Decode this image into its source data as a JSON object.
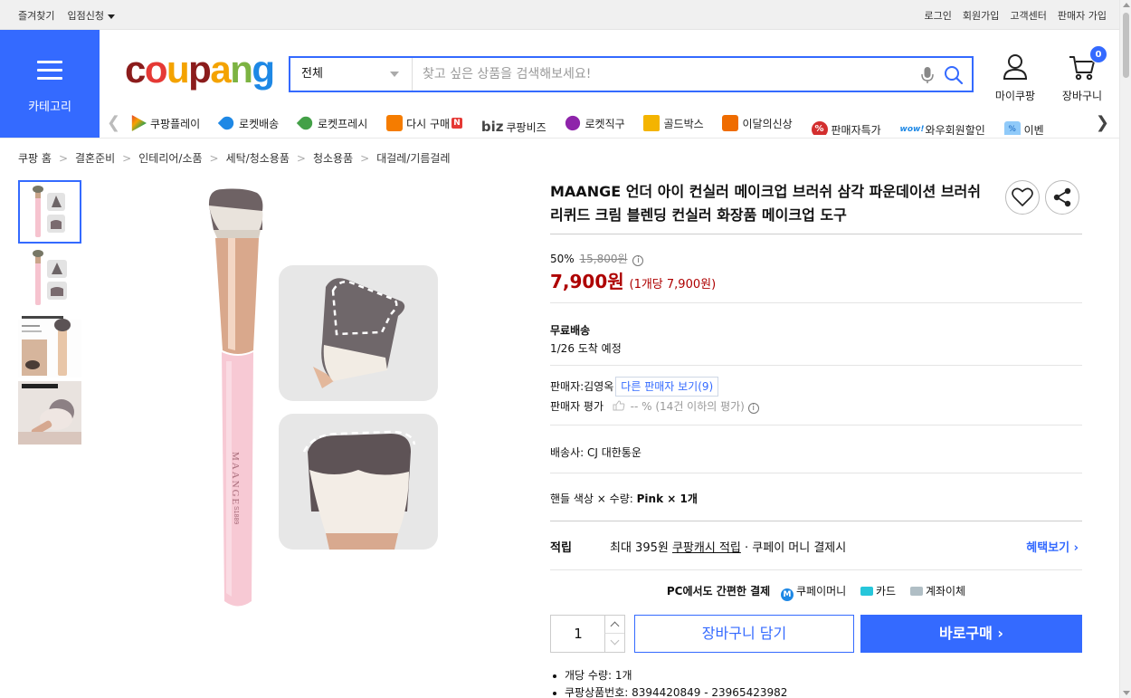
{
  "topbar": {
    "favorites": "즐겨찾기",
    "apply": "입점신청",
    "login": "로그인",
    "signup": "회원가입",
    "customer_center": "고객센터",
    "seller_signup": "판매자 가입"
  },
  "header": {
    "category_label": "카테고리",
    "logo": [
      "c",
      "o",
      "u",
      "p",
      "a",
      "n",
      "g"
    ],
    "search": {
      "category": "전체",
      "placeholder": "찾고 싶은 상품을 검색해보세요!"
    },
    "mycoupang": "마이쿠팡",
    "cart": "장바구니",
    "cart_count": "0",
    "brand_color": "#346aff"
  },
  "service_nav": [
    {
      "icon": "play-icon",
      "label": "쿠팡플레이"
    },
    {
      "icon": "rocket-delivery-icon",
      "label": "로켓배송"
    },
    {
      "icon": "rocket-fresh-icon",
      "label": "로켓프레시"
    },
    {
      "icon": "reorder-icon",
      "label": "다시 구매",
      "badge": "N"
    },
    {
      "icon": "biz-icon",
      "label": "쿠팡비즈",
      "prefix": "biz"
    },
    {
      "icon": "rocket-direct-icon",
      "label": "로켓직구"
    },
    {
      "icon": "goldbox-icon",
      "label": "골드박스"
    },
    {
      "icon": "new-product-icon",
      "label": "이달의신상"
    },
    {
      "icon": "percent-icon",
      "label": "판매자특가",
      "prefix": "%"
    },
    {
      "icon": "wow-icon",
      "label": "와우회원할인",
      "prefix": "wow!"
    },
    {
      "icon": "event-icon",
      "label": "이벤",
      "prefix": "%"
    }
  ],
  "breadcrumb": [
    "쿠팡 홈",
    "결혼준비",
    "인테리어/소품",
    "세탁/청소용품",
    "청소용품",
    "대걸레/기름걸레"
  ],
  "product": {
    "title": "MAANGE 언더 아이 컨실러 메이크업 브러쉬 삼각 파운데이션 브러쉬 리퀴드 크림 블렌딩 컨실러 화장품 메이크업 도구",
    "brush_text": "MAANGE",
    "brush_code": "S1889",
    "discount_rate": "50%",
    "original_price": "15,800원",
    "price": "7,900원",
    "unit_price": "(1개당 7,900원)",
    "shipping_title": "무료배송",
    "arrival": "1/26 도착 예정",
    "seller_label": "판매자:",
    "seller_name": "김영옥",
    "other_sellers": "다른 판매자 보기(9)",
    "seller_rating_label": "판매자 평가",
    "seller_rating_value": "-- % (14건 이하의 평가)",
    "courier": "배송사:  CJ 대한통운",
    "option_label": "핸들 색상 × 수량:",
    "option_value": "Pink × 1개",
    "reward_label": "적립",
    "reward_prefix": "최대 395원",
    "reward_link": "쿠팡캐시 적립",
    "reward_suffix": "· 쿠페이 머니 결제시",
    "reward_more": "혜택보기",
    "pc_pay_label": "PC에서도 간편한 결제",
    "pay_coupay": "쿠페이머니",
    "pay_card": "카드",
    "pay_bank": "계좌이체",
    "quantity": "1",
    "add_to_cart": "장바구니 담기",
    "buy_now": "바로구매",
    "bullets": [
      "개당 수량: 1개",
      "쿠팡상품번호: 8394420849 - 23965423982"
    ],
    "price_color": "#ae0000"
  }
}
